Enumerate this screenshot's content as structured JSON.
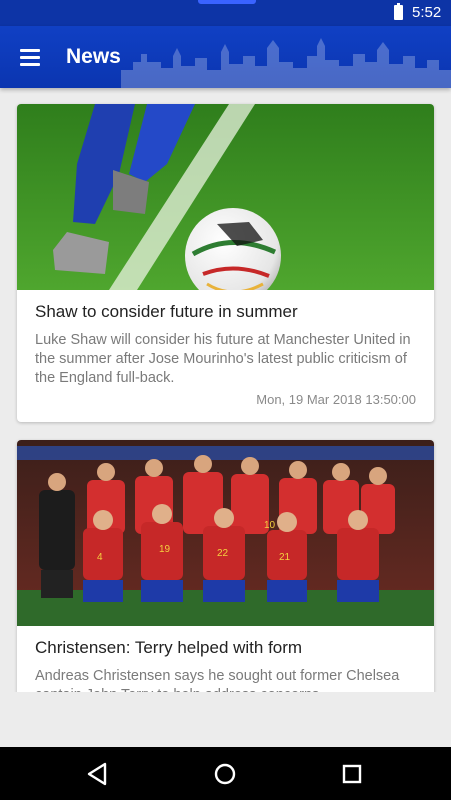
{
  "status_bar": {
    "time": "5:52",
    "battery_icon": "battery-icon"
  },
  "app_bar": {
    "title": "News",
    "menu_icon": "hamburger-menu-icon"
  },
  "colors": {
    "primary": "#0d34a6",
    "card_bg": "#ffffff",
    "background": "#ececec"
  },
  "articles": [
    {
      "title": "Shaw to consider future in summer",
      "summary": "Luke Shaw will consider his future at Manchester United in the summer after Jose Mourinho's latest public criticism of the England full-back.",
      "date": "Mon, 19 Mar 2018 13:50:00",
      "image": "football-on-pitch-photo"
    },
    {
      "title": "Christensen: Terry helped with form",
      "summary": "Andreas Christensen says he sought out former Chelsea captain John Terry to help address concerns",
      "image": "team-photo-red-kits"
    }
  ],
  "nav_bar": {
    "back_icon": "back-icon",
    "home_icon": "home-icon",
    "recents_icon": "recents-icon"
  }
}
